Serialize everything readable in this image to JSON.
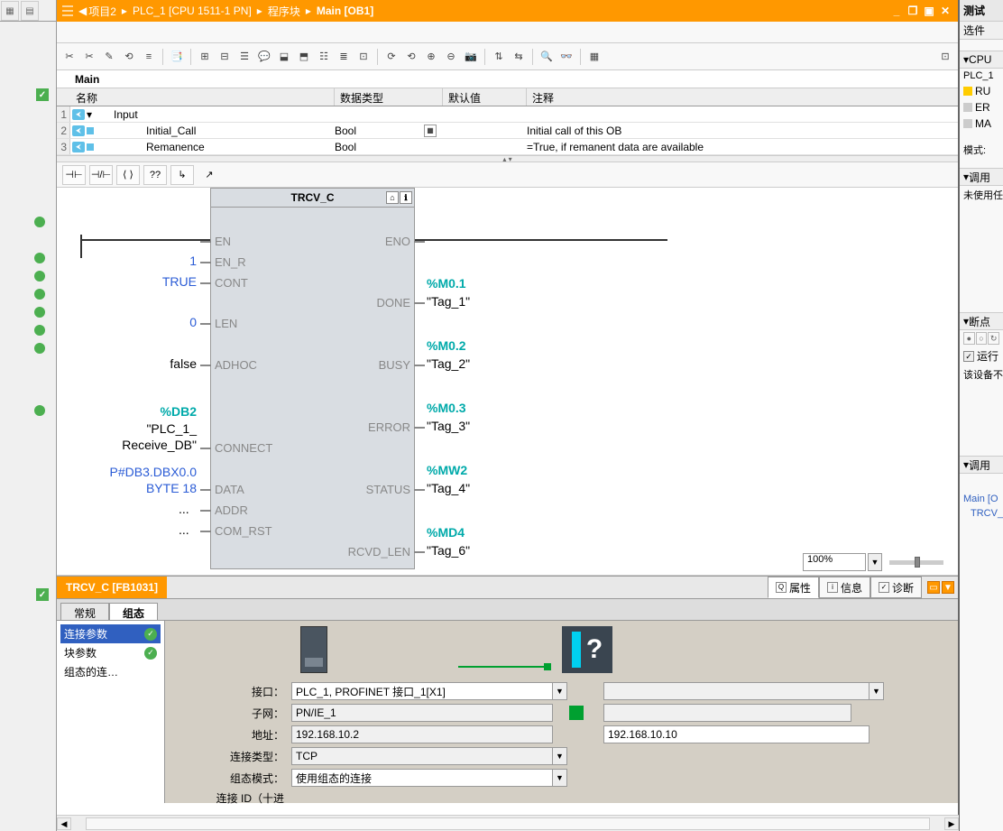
{
  "breadcrumb": {
    "p1": "项目2",
    "p2": "PLC_1 [CPU 1511-1 PN]",
    "p3": "程序块",
    "p4": "Main [OB1]"
  },
  "iface": {
    "title": "Main",
    "headers": {
      "name": "名称",
      "type": "数据类型",
      "def": "默认值",
      "comm": "注释"
    },
    "rows": [
      {
        "num": "1",
        "name": "Input",
        "type": "",
        "def": "",
        "comm": ""
      },
      {
        "num": "2",
        "name": "Initial_Call",
        "type": "Bool",
        "def": "",
        "comm": "Initial call of this OB"
      },
      {
        "num": "3",
        "name": "Remanence",
        "type": "Bool",
        "def": "",
        "comm": "=True, if remanent data are available"
      }
    ]
  },
  "lad_tb": {
    "b1": "⊣⊢",
    "b2": "⊣/⊢",
    "b3": "⟨ ⟩",
    "b4": "??",
    "b5": "↳",
    "b6": "↗"
  },
  "fb": {
    "title": "TRCV_C",
    "pins_l": {
      "en": "EN",
      "en_r": "EN_R",
      "cont": "CONT",
      "len": "LEN",
      "adhoc": "ADHOC",
      "connect": "CONNECT",
      "data": "DATA",
      "addr": "ADDR",
      "com_rst": "COM_RST"
    },
    "pins_r": {
      "eno": "ENO",
      "done": "DONE",
      "busy": "BUSY",
      "error": "ERROR",
      "status": "STATUS",
      "rcvd_len": "RCVD_LEN"
    },
    "in_vals": {
      "en_r": "1",
      "cont": "TRUE",
      "len": "0",
      "adhoc": "false",
      "db2": "%DB2",
      "plc1": "\"PLC_1_",
      "recvdb": "Receive_DB\"",
      "ptr": "P#DB3.DBX0.0",
      "byte": "BYTE 18",
      "dots1": "...",
      "dots2": "..."
    },
    "out_vals": {
      "m01": "%M0.1",
      "t1": "\"Tag_1\"",
      "m02": "%M0.2",
      "t2": "\"Tag_2\"",
      "m03": "%M0.3",
      "t3": "\"Tag_3\"",
      "mw2": "%MW2",
      "t4": "\"Tag_4\"",
      "md4": "%MD4",
      "t6": "\"Tag_6\""
    }
  },
  "zoom": "100%",
  "inspector": {
    "title": "TRCV_C [FB1031]",
    "tabs": {
      "prop": "属性",
      "info": "信息",
      "diag": "诊断"
    }
  },
  "cfg_tabs": {
    "gen": "常规",
    "conf": "组态"
  },
  "cfg_nav": {
    "conn_param": "连接参数",
    "block_param": "块参数",
    "conf_conn": "组态的连…"
  },
  "cfg_form": {
    "l_iface": "接口：",
    "l_subnet": "子网：",
    "l_addr": "地址：",
    "l_conntype": "连接类型：",
    "l_confmode": "组态模式：",
    "l_connid": "连接 ID（十进",
    "v_iface": "PLC_1, PROFINET 接口_1[X1]",
    "v_subnet": "PN/IE_1",
    "v_addr_l": "192.168.10.2",
    "v_addr_r": "192.168.10.10",
    "v_conntype": "TCP",
    "v_confmode": "使用组态的连接"
  },
  "right": {
    "title": "测试",
    "opts": "选件",
    "sec_cpu": "CPU",
    "plc1": "PLC_1",
    "ru": "RU",
    "er": "ER",
    "ma": "MA",
    "mode": "模式:",
    "sec_call": "调用",
    "not_used": "未使用任",
    "sec_bp": "断点",
    "run": "运行",
    "dev_not": "该设备不",
    "sec_call2": "调用",
    "main": "Main [O",
    "trcv": "TRCV_"
  }
}
